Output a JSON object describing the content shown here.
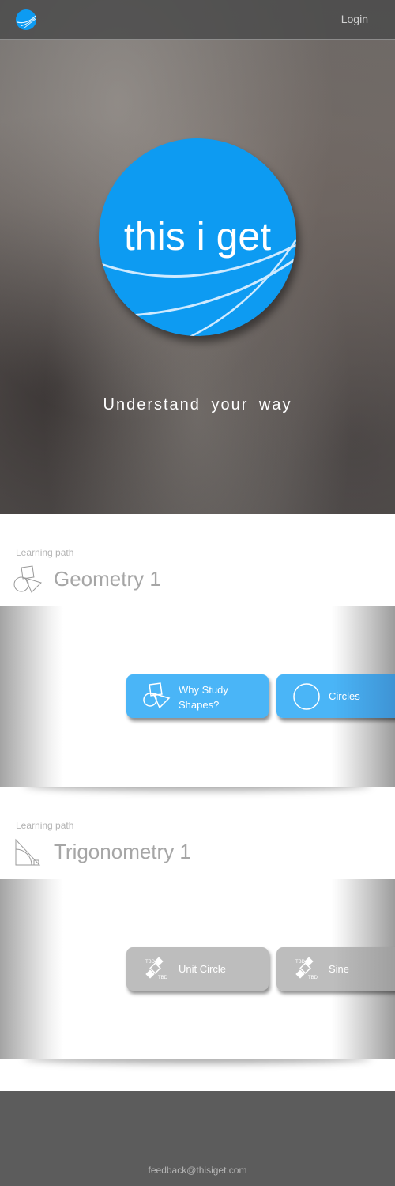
{
  "header": {
    "logo_icon": "globe-swoosh-icon",
    "login_label": "Login"
  },
  "hero": {
    "brand": "this i get",
    "tagline": "Understand your way",
    "brand_color": "#0d9bf2"
  },
  "paths": [
    {
      "label": "Learning path",
      "title": "Geometry 1",
      "icon": "shapes-icon",
      "lessons": [
        {
          "label": "Why Study Shapes?",
          "icon": "shapes-icon",
          "color": "#4ab5f7"
        },
        {
          "label": "Circles",
          "icon": "circle-icon",
          "color": "#4ab5f7"
        }
      ]
    },
    {
      "label": "Learning path",
      "title": "Trigonometry 1",
      "icon": "right-triangle-icon",
      "lessons": [
        {
          "label": "Unit Circle",
          "icon": "tbd-icon",
          "icon_text": "TBD",
          "color": "#bdbdbd"
        },
        {
          "label": "Sine",
          "icon": "tbd-icon",
          "icon_text": "TBD",
          "color": "#bdbdbd"
        }
      ]
    }
  ],
  "footer": {
    "email": "feedback@thisiget.com"
  }
}
